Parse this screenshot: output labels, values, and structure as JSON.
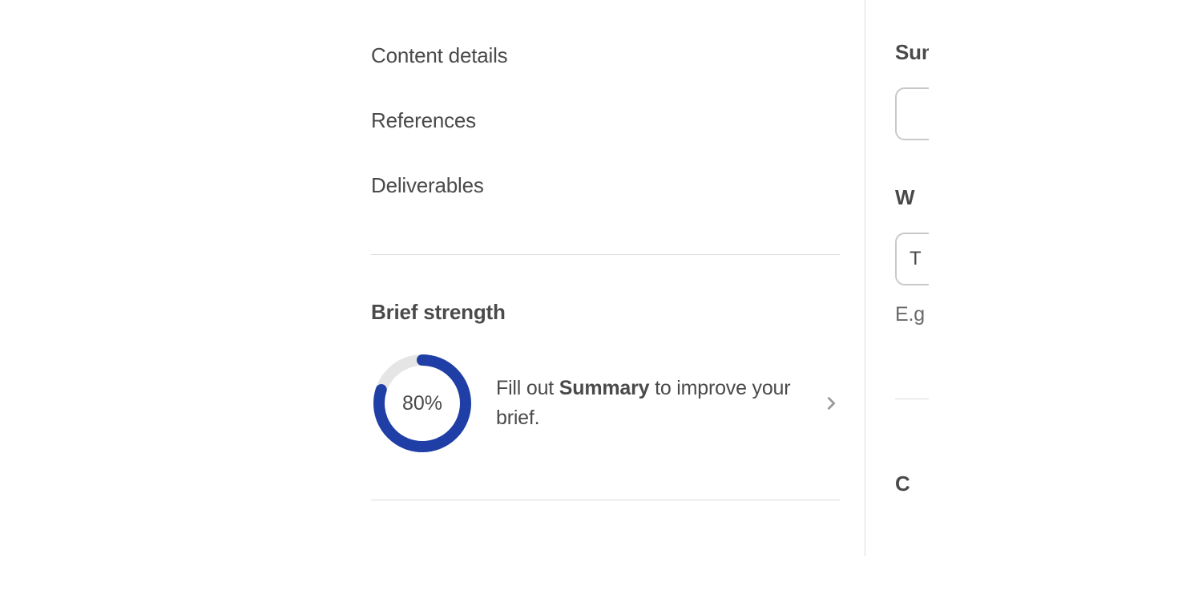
{
  "nav": {
    "items": [
      {
        "label": "Content details"
      },
      {
        "label": "References"
      },
      {
        "label": "Deliverables"
      }
    ]
  },
  "brief": {
    "heading": "Brief strength",
    "percent": 80,
    "percent_label": "80%",
    "hint_prefix": "Fill out ",
    "hint_bold": "Summary",
    "hint_suffix": " to improve your brief."
  },
  "right": {
    "label1": "Summary",
    "label2": "W",
    "input2_value": "T",
    "helper": "E.g",
    "label3": "C"
  },
  "colors": {
    "progress": "#1f3fa6",
    "progress_bg": "#e5e5e5",
    "divider": "#dcdcdc",
    "text": "#4a4a4a"
  }
}
